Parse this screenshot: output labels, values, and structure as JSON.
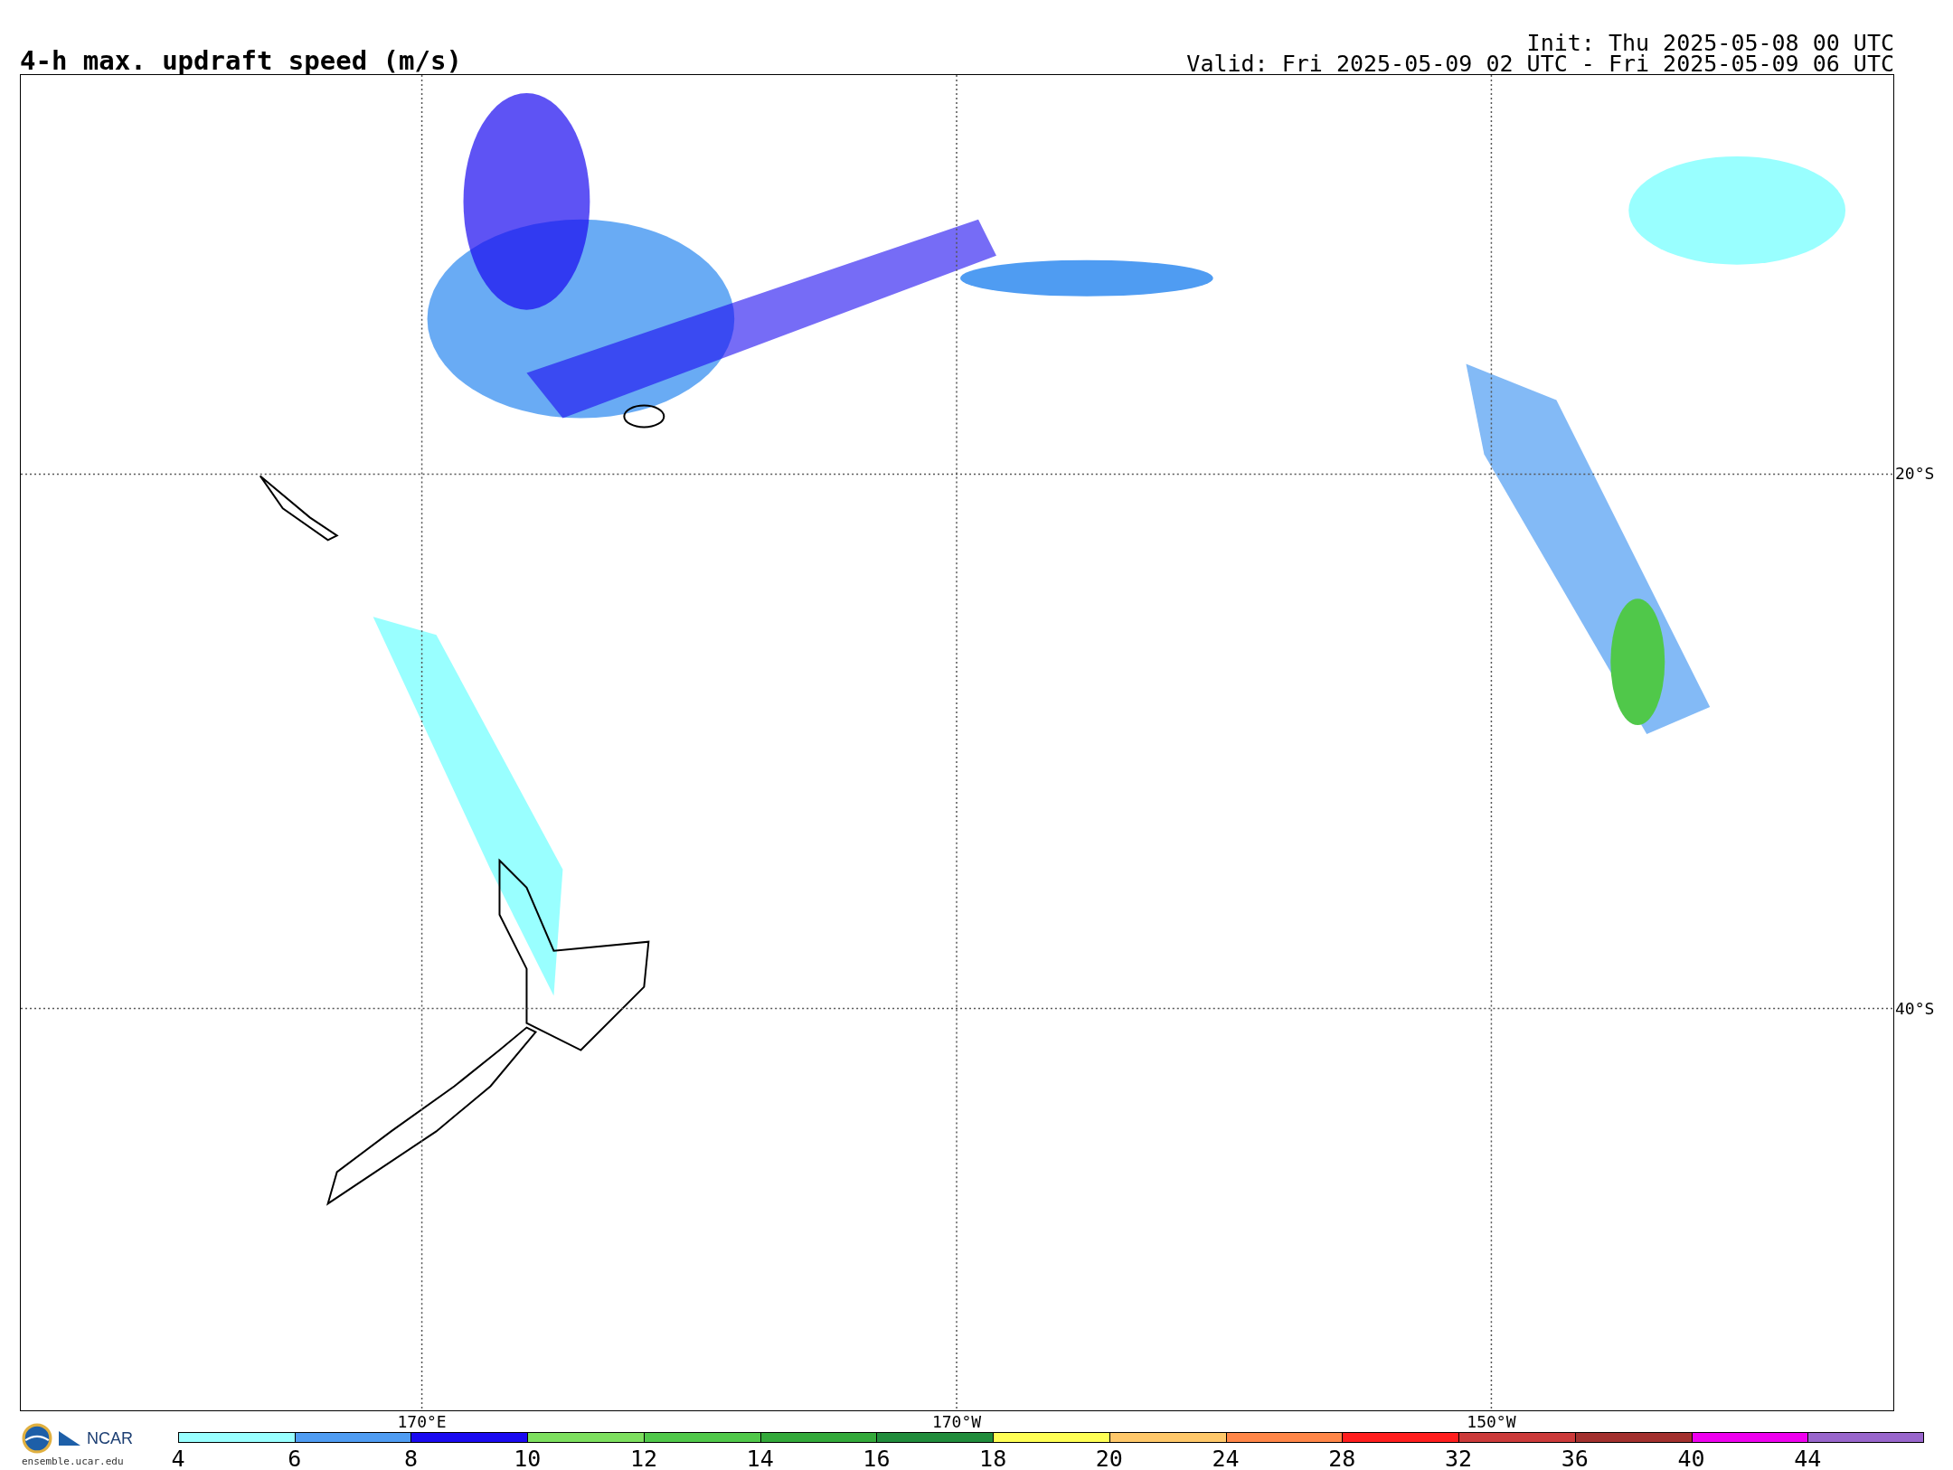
{
  "title": "4-h max. updraft speed (m/s)",
  "init": "Init: Thu 2025-05-08 00 UTC",
  "valid": "Valid: Fri 2025-05-09 02 UTC - Fri 2025-05-09 06 UTC",
  "map": {
    "lat_labels": [
      "20°S",
      "40°S"
    ],
    "lon_labels": [
      "170°E",
      "170°W",
      "150°W"
    ]
  },
  "logo": {
    "name": "NCAR",
    "url": "ensemble.ucar.edu"
  },
  "colorbar": [
    {
      "label": "4",
      "color": "#99ffff"
    },
    {
      "label": "6",
      "color": "#4f9cf2"
    },
    {
      "label": "8",
      "color": "#1a0af0"
    },
    {
      "label": "10",
      "color": "#7ddf5f"
    },
    {
      "label": "12",
      "color": "#50c84a"
    },
    {
      "label": "14",
      "color": "#33a93a"
    },
    {
      "label": "16",
      "color": "#218c3c"
    },
    {
      "label": "18",
      "color": "#ffff55"
    },
    {
      "label": "20",
      "color": "#ffc86a"
    },
    {
      "label": "24",
      "color": "#ff8648"
    },
    {
      "label": "28",
      "color": "#ff1e1e"
    },
    {
      "label": "32",
      "color": "#cc3a3a"
    },
    {
      "label": "36",
      "color": "#a3302e"
    },
    {
      "label": "40",
      "color": "#ee00ee"
    },
    {
      "label": "44",
      "color": "#9966cc"
    }
  ]
}
